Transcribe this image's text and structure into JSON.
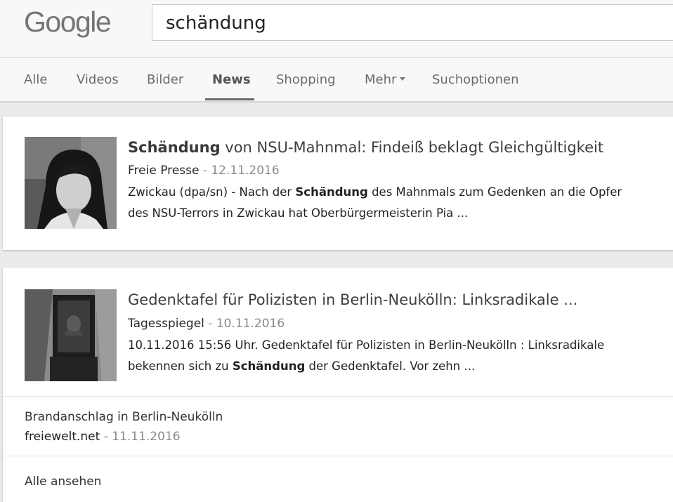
{
  "header": {
    "logo": "Google",
    "search_query": "schändung"
  },
  "tabs": [
    {
      "label": "Alle"
    },
    {
      "label": "Videos"
    },
    {
      "label": "Bilder"
    },
    {
      "label": "News",
      "active": true
    },
    {
      "label": "Shopping"
    },
    {
      "label": "Mehr"
    },
    {
      "label": "Suchoptionen"
    }
  ],
  "results": [
    {
      "title_bold": "Schändung",
      "title_rest": " von NSU-Mahnmal: Findeiß beklagt Gleichgültigkeit",
      "source": "Freie Presse",
      "date": " - 12.11.2016",
      "snippet_line1_pre": "Zwickau (dpa/sn) - Nach der ",
      "snippet_line1_bold": "Schändung",
      "snippet_line1_post": " des Mahnmals zum Gedenken an die Opfer",
      "snippet_line2": "des NSU-Terrors in Zwickau hat Oberbürgermeisterin Pia ..."
    },
    {
      "title": "Gedenktafel für Polizisten in Berlin-Neukölln: Linksradikale ...",
      "source": "Tagesspiegel",
      "date": " - 10.11.2016",
      "snippet_line1": "10.11.2016 15:56 Uhr. Gedenktafel für Polizisten in Berlin-Neukölln : Linksradikale",
      "snippet_line2_pre": "bekennen sich zu ",
      "snippet_line2_bold": "Schändung",
      "snippet_line2_post": " der Gedenktafel. Vor zehn ...",
      "related": {
        "title": "Brandanschlag in Berlin-Neukölln",
        "source": "freiewelt.net",
        "date": " - 11.11.2016"
      },
      "see_all": "Alle ansehen"
    }
  ],
  "colors": {
    "background": "#ebebeb",
    "header_bg": "#f8f8f8",
    "card_bg": "#ffffff",
    "date_gray": "#8a8a8a"
  }
}
